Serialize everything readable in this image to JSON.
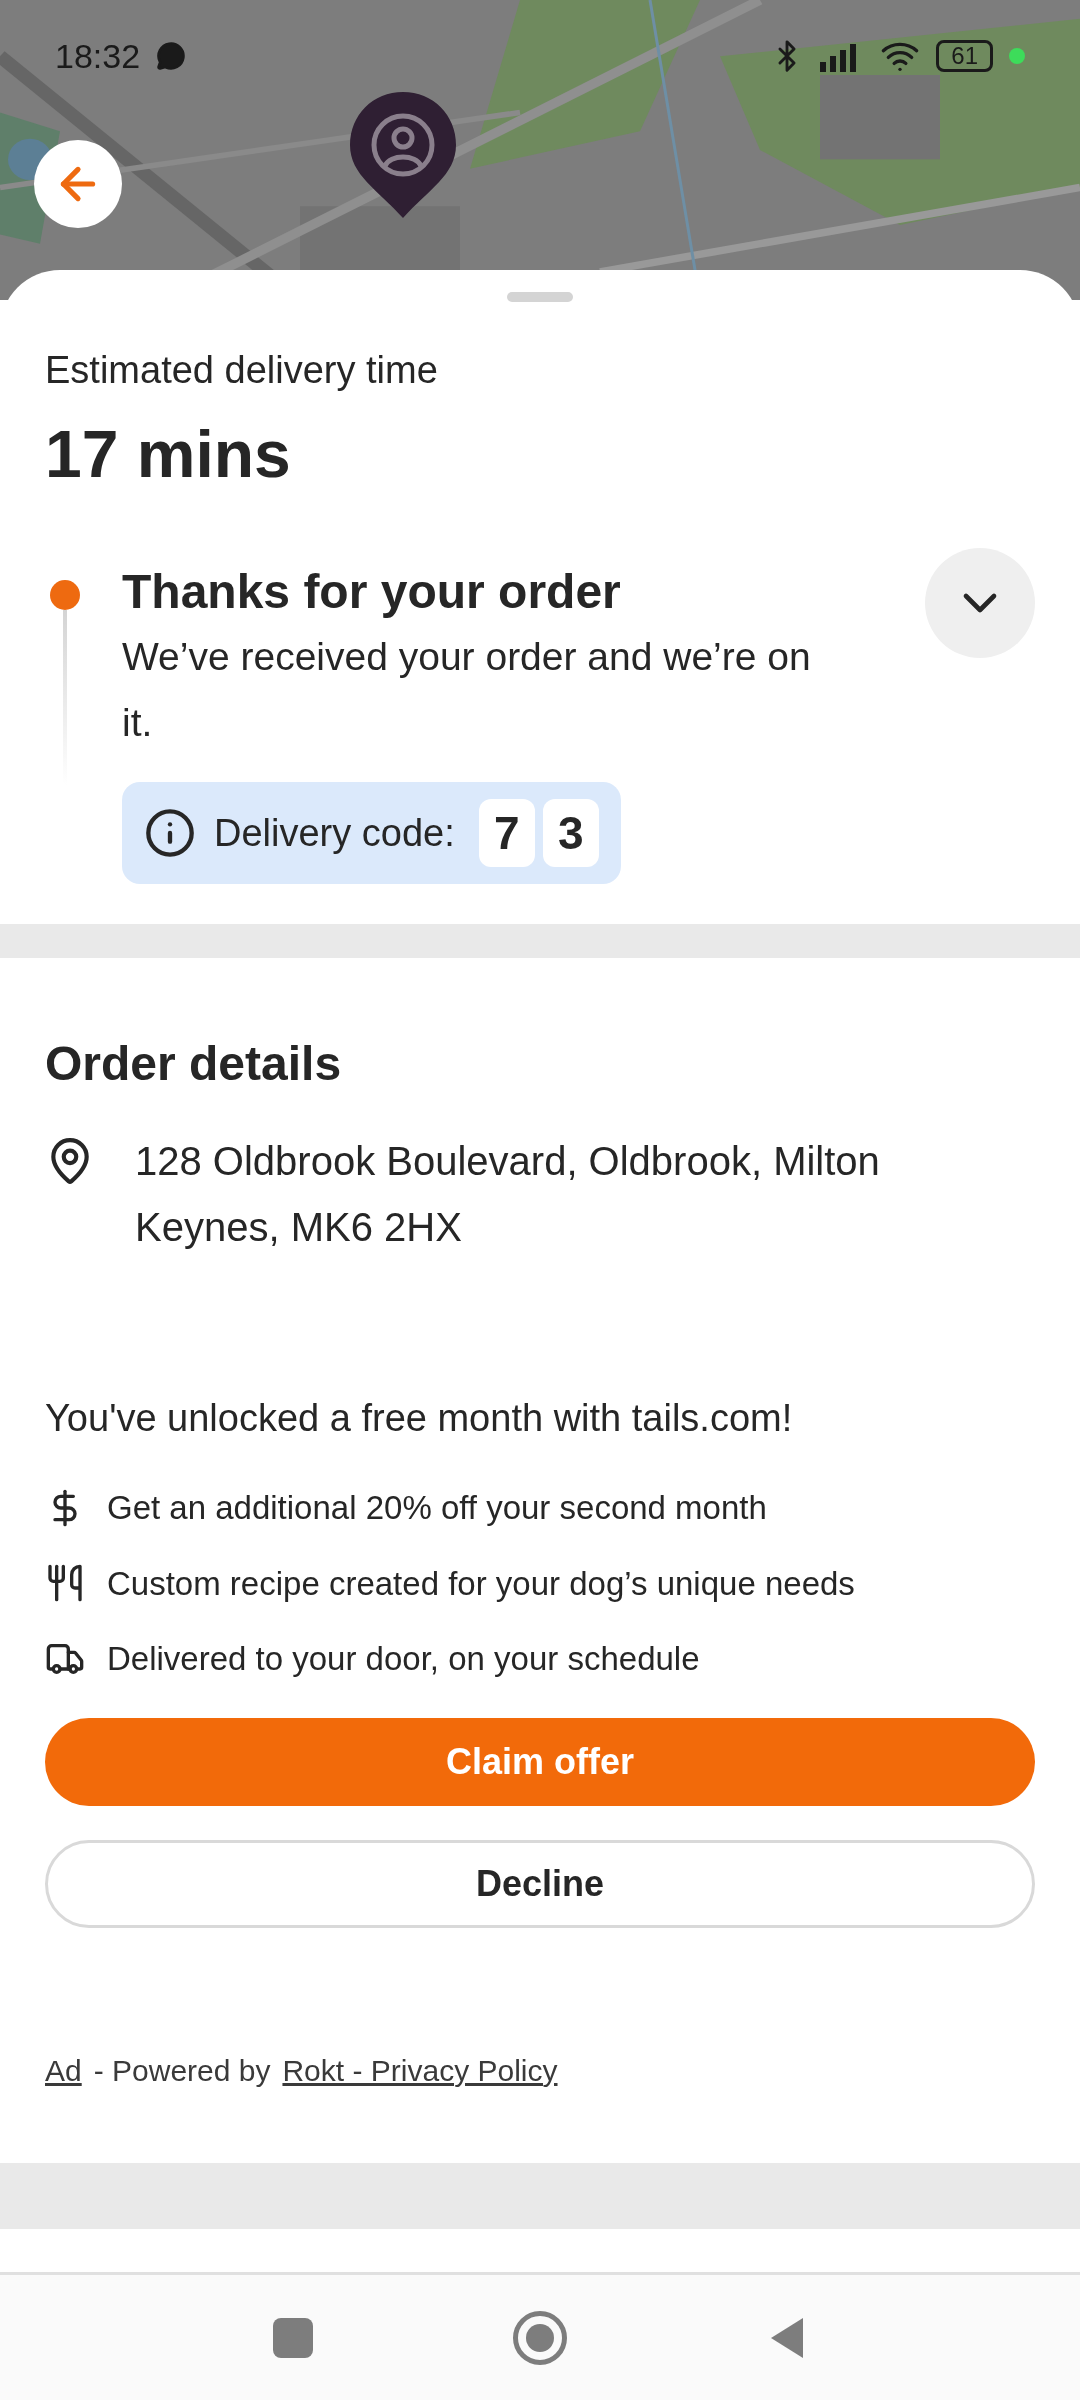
{
  "status_bar": {
    "time": "18:32",
    "battery": "61"
  },
  "delivery": {
    "label": "Estimated delivery time",
    "eta": "17 mins"
  },
  "status_steps": [
    {
      "title": "Thanks for your order",
      "description": "We’ve received your order and we’re on it.",
      "active": true
    }
  ],
  "details_toggle": {
    "expanded": false
  },
  "delivery_code": {
    "label": "Delivery code:",
    "digits": [
      "7",
      "3"
    ]
  },
  "order_details": {
    "title": "Order details",
    "address": "128 Oldbrook Boulevard, Oldbrook, Milton Keynes, MK6 2HX"
  },
  "offer": {
    "headline": "You've unlocked a free month with tails.com!",
    "benefits": [
      {
        "kind": "price",
        "text": "Get an additional 20% off your second month"
      },
      {
        "kind": "recipe",
        "text": "Custom recipe created for your dog’s unique needs"
      },
      {
        "kind": "delivery",
        "text": "Delivered to your door, on your schedule"
      }
    ],
    "buttons": [
      {
        "kind": "primary",
        "label": "Claim offer"
      },
      {
        "kind": "secondary",
        "label": "Decline"
      }
    ],
    "footer": [
      {
        "text": "Ad",
        "link": true
      },
      {
        "text": "- Powered by",
        "link": false
      },
      {
        "text": "Rokt - Privacy Policy",
        "link": true
      }
    ]
  }
}
